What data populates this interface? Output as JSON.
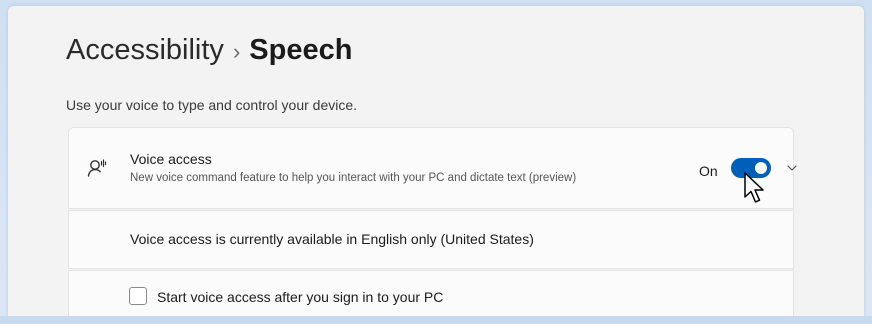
{
  "header": {
    "breadcrumb_parent": "Accessibility",
    "breadcrumb_separator": "›",
    "page_title": "Speech",
    "subtitle": "Use your voice to type and control your device."
  },
  "voice_access": {
    "icon": "voice-access-icon",
    "title": "Voice access",
    "description": "New voice command feature to help you interact with your PC and dictate text (preview)",
    "toggle_state_label": "On",
    "toggle_on": true,
    "expand_icon": "chevron-down-icon"
  },
  "availability_note": "Voice access is currently available in English only (United States)",
  "startup_option": {
    "label": "Start voice access after you sign in to your PC",
    "checked": false
  },
  "colors": {
    "accent": "#005fb8",
    "background": "#f3f3f3",
    "card": "#fbfbfb"
  }
}
